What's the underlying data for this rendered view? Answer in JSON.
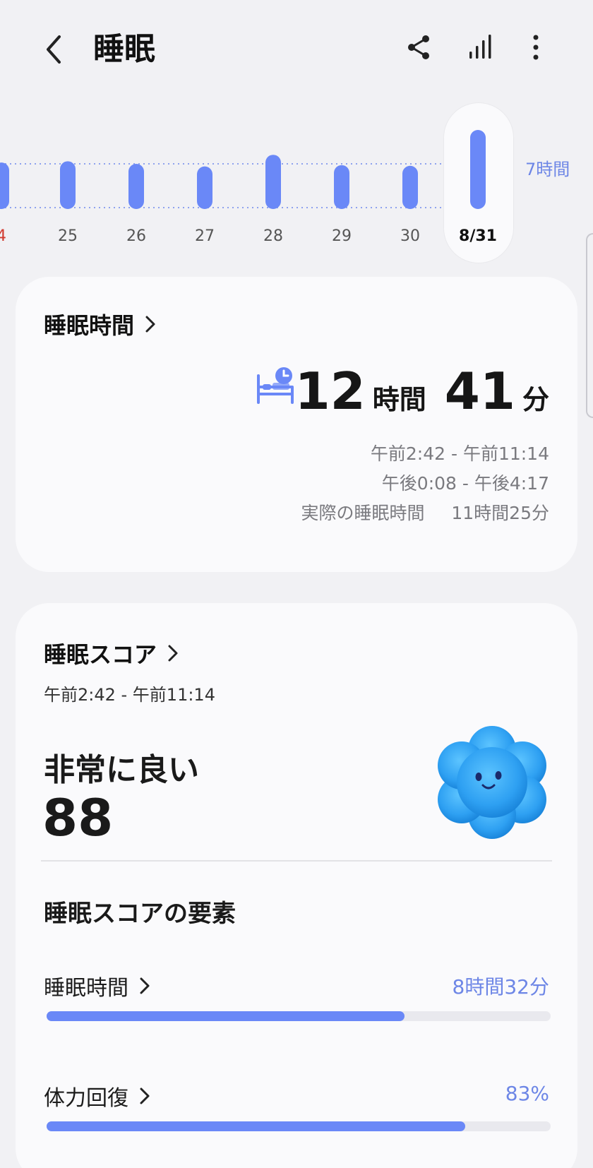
{
  "header": {
    "title": "睡眠",
    "back_icon": "chevron-left-icon",
    "actions": [
      "share-icon",
      "bar-chart-icon",
      "more-vert-icon"
    ]
  },
  "chart_data": {
    "type": "bar",
    "categories": [
      "4",
      "25",
      "26",
      "27",
      "28",
      "29",
      "30",
      "8/31"
    ],
    "values": [
      7.2,
      7.4,
      7.0,
      6.6,
      8.4,
      6.8,
      6.7,
      12.7
    ],
    "goal_label": "7時間",
    "goal_value": 7,
    "selected": "8/31",
    "highlight_colors": {
      "bar": "#6a88f7",
      "weekend_label": "#d13a2f"
    }
  },
  "duration_card": {
    "title": "睡眠時間",
    "hours": "12",
    "hours_unit": "時間",
    "minutes": "41",
    "minutes_unit": "分",
    "sessions": [
      "午前2:42 - 午前11:14",
      "午後0:08 - 午後4:17"
    ],
    "actual_label": "実際の睡眠時間",
    "actual_value": "11時間25分"
  },
  "score_card": {
    "title": "睡眠スコア",
    "time_range": "午前2:42 - 午前11:14",
    "rating": "非常に良い",
    "score": "88",
    "factors_title": "睡眠スコアの要素",
    "factors": [
      {
        "label": "睡眠時間",
        "value": "8時間32分",
        "progress": 0.71
      },
      {
        "label": "体力回復",
        "value": "83%",
        "progress": 0.83
      }
    ]
  },
  "colors": {
    "accent": "#6a88f7",
    "text_accent": "#6d86e6",
    "background": "#f1f1f4",
    "card": "#fafafc"
  }
}
